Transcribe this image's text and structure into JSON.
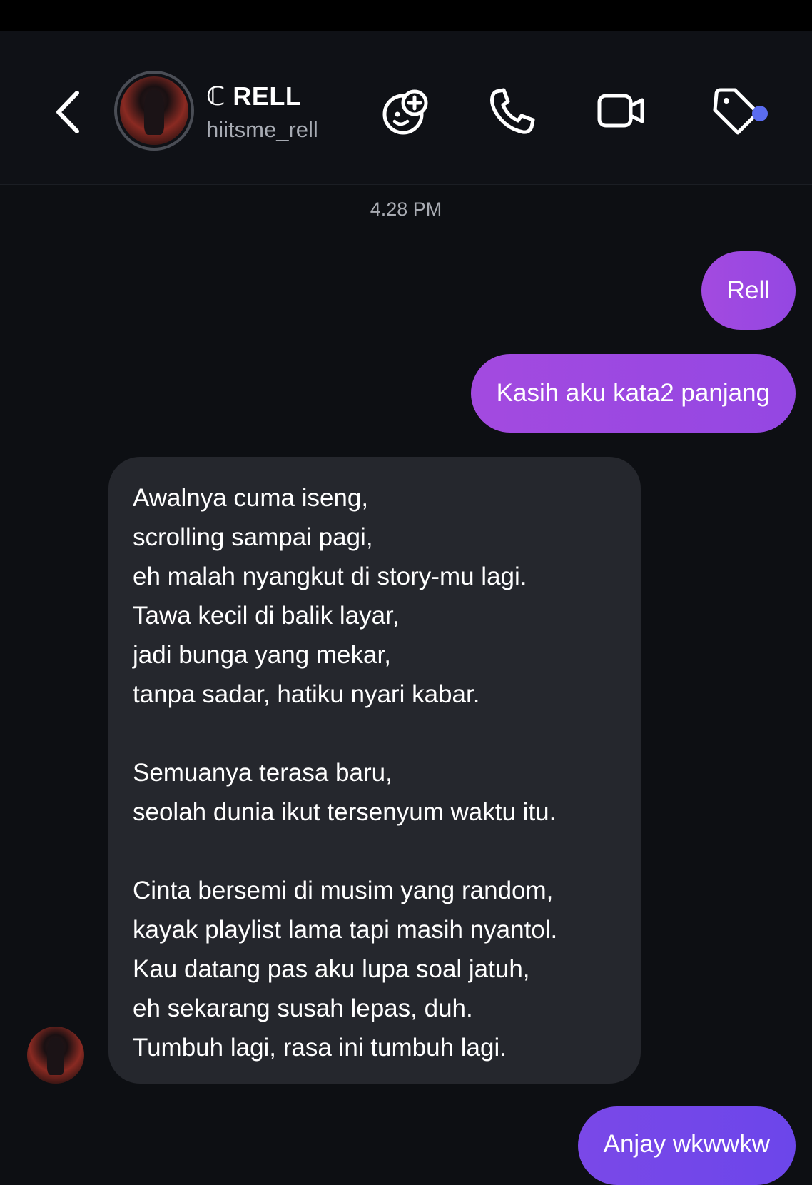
{
  "header": {
    "name": "ℂ RELL",
    "handle": "hiitsme_rell",
    "icons": [
      "back-icon",
      "game-icon",
      "phone-icon",
      "video-icon",
      "tag-icon"
    ],
    "notification_dot_color": "#5a6cf0"
  },
  "chat": {
    "timestamp": "4.28 PM",
    "messages": [
      {
        "direction": "outgoing",
        "text": "Rell"
      },
      {
        "direction": "outgoing",
        "text": "Kasih aku kata2 panjang"
      },
      {
        "direction": "incoming",
        "lines": [
          "Awalnya cuma iseng,",
          "scrolling sampai pagi,",
          "eh malah nyangkut di story-mu lagi.",
          "Tawa kecil di balik layar,",
          "jadi bunga yang mekar,",
          "tanpa sadar, hatiku nyari kabar.",
          "",
          "Semuanya terasa baru,",
          "seolah dunia ikut tersenyum waktu itu.",
          "",
          "Cinta bersemi di musim yang random,",
          "kayak playlist lama tapi masih nyantol.",
          "Kau datang pas aku lupa soal jatuh,",
          "eh sekarang susah lepas, duh.",
          "Tumbuh lagi, rasa ini tumbuh lagi."
        ]
      },
      {
        "direction": "outgoing",
        "text": "Anjay wkwwkw"
      }
    ]
  },
  "colors": {
    "background": "#0d0f13",
    "outgoing_bubble": "#9d49e1",
    "outgoing_bubble_last": "#7347e9",
    "incoming_bubble": "#25272d"
  }
}
